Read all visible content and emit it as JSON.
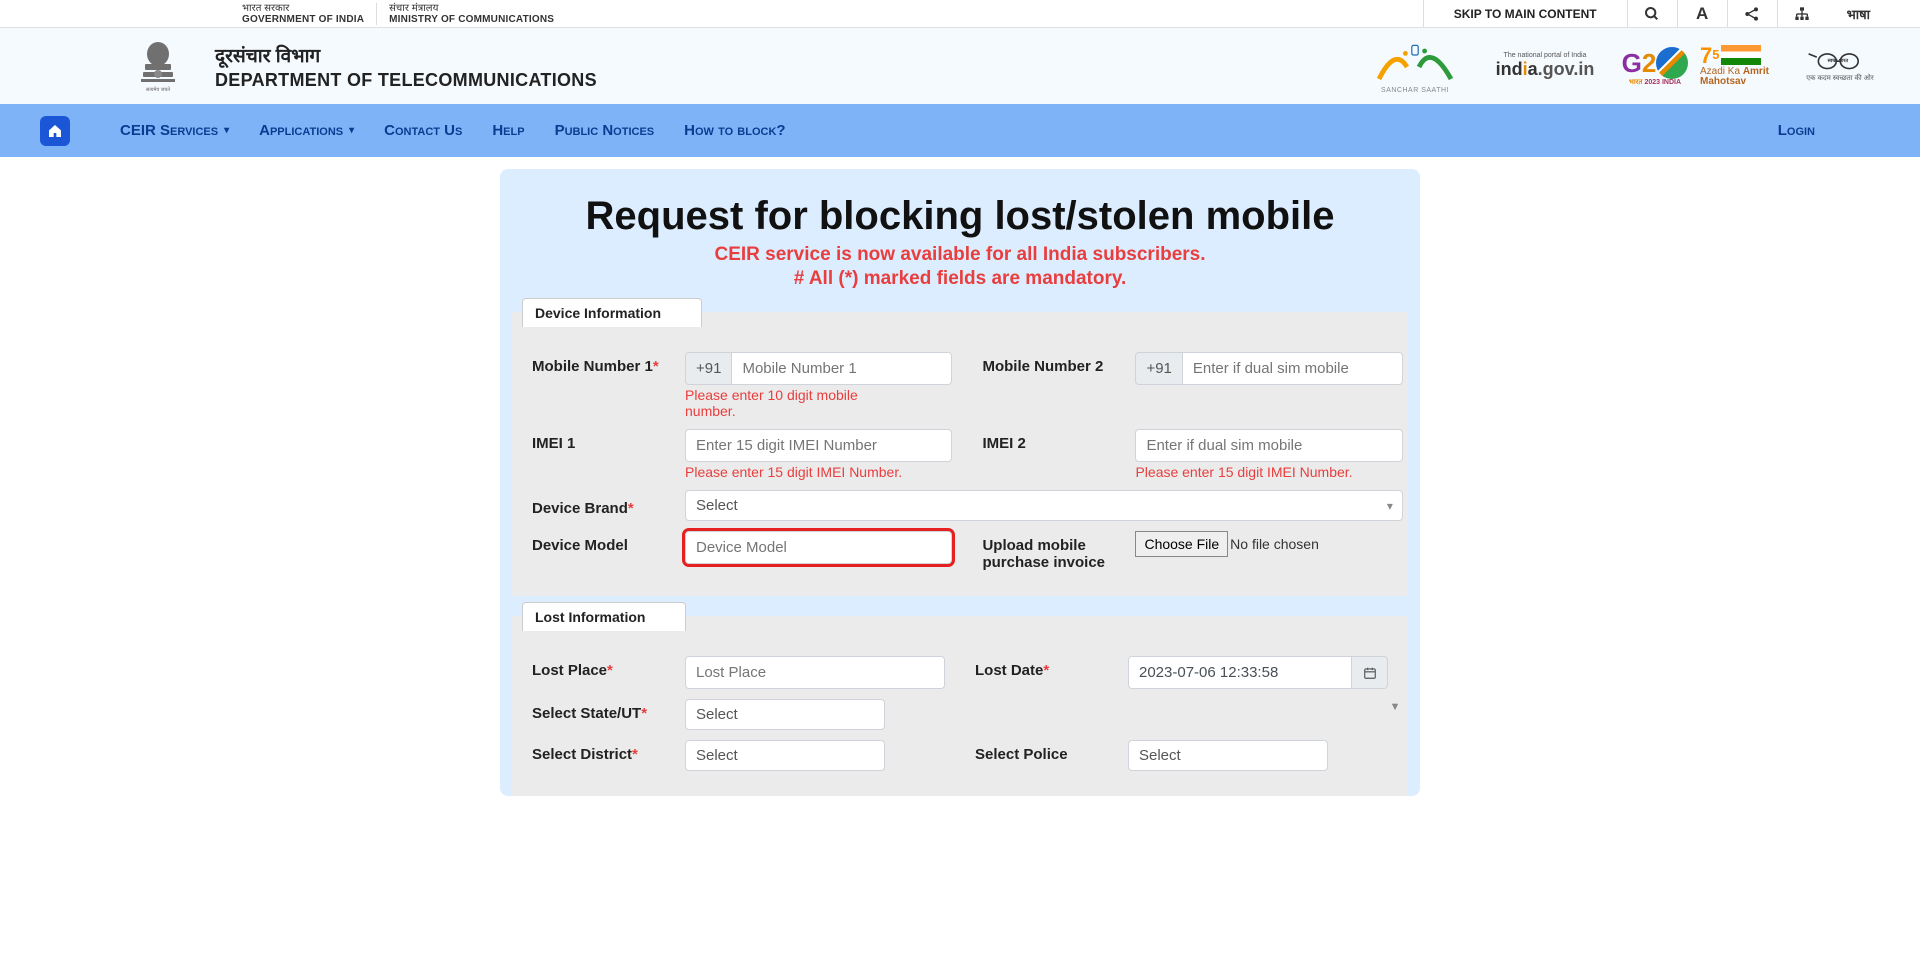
{
  "topbar": {
    "gov1_hindi": "भारत सरकार",
    "gov1_eng": "GOVERNMENT OF INDIA",
    "gov2_hindi": "संचार मंत्रालय",
    "gov2_eng": "MINISTRY OF COMMUNICATIONS",
    "skip": "SKIP TO MAIN CONTENT",
    "lang": "भाषा"
  },
  "header": {
    "dept_hindi": "दूरसंचार विभाग",
    "dept_eng": "DEPARTMENT OF TELECOMMUNICATIONS",
    "logos": {
      "saathi": "SANCHAR SAATHI",
      "indiagov": "india.gov.in",
      "g20_sub": "2023 INDIA",
      "amrit1": "Azadi Ka",
      "amrit2": "Amrit Mahotsav",
      "swbharat": "एक कदम स्वच्छता की ओर"
    }
  },
  "nav": {
    "ceir": "CEIR Services",
    "applications": "Applications",
    "contact": "Contact Us",
    "help": "Help",
    "notices": "Public Notices",
    "howto": "How to block?",
    "login": "Login"
  },
  "page": {
    "title": "Request for blocking lost/stolen mobile",
    "sub1": "CEIR service is now available for all India subscribers.",
    "sub2": "# All (*) marked fields are mandatory."
  },
  "deviceInfo": {
    "legend": "Device Information",
    "mobile1_label": "Mobile Number 1",
    "mobile1_prefix": "+91",
    "mobile1_placeholder": "Mobile Number 1",
    "mobile1_error": "Please enter 10 digit mobile number.",
    "mobile2_label": "Mobile Number 2",
    "mobile2_prefix": "+91",
    "mobile2_placeholder": "Enter if dual sim mobile",
    "imei1_label": "IMEI 1",
    "imei1_placeholder": "Enter 15 digit IMEI Number",
    "imei1_error": "Please enter 15 digit IMEI Number.",
    "imei2_label": "IMEI 2",
    "imei2_placeholder": "Enter if dual sim mobile",
    "imei2_error": "Please enter 15 digit IMEI Number.",
    "brand_label": "Device Brand",
    "brand_select": "Select",
    "model_label": "Device Model",
    "model_placeholder": "Device Model",
    "upload_label": "Upload mobile purchase invoice",
    "choose_file": "Choose File",
    "no_file": "No file chosen"
  },
  "lostInfo": {
    "legend": "Lost Information",
    "place_label": "Lost Place",
    "place_placeholder": "Lost Place",
    "date_label": "Lost Date",
    "date_value": "2023-07-06 12:33:58",
    "state_label": "Select State/UT",
    "state_select": "Select",
    "district_label": "Select District",
    "district_select": "Select",
    "police_label": "Select Police",
    "police_select": "Select"
  }
}
